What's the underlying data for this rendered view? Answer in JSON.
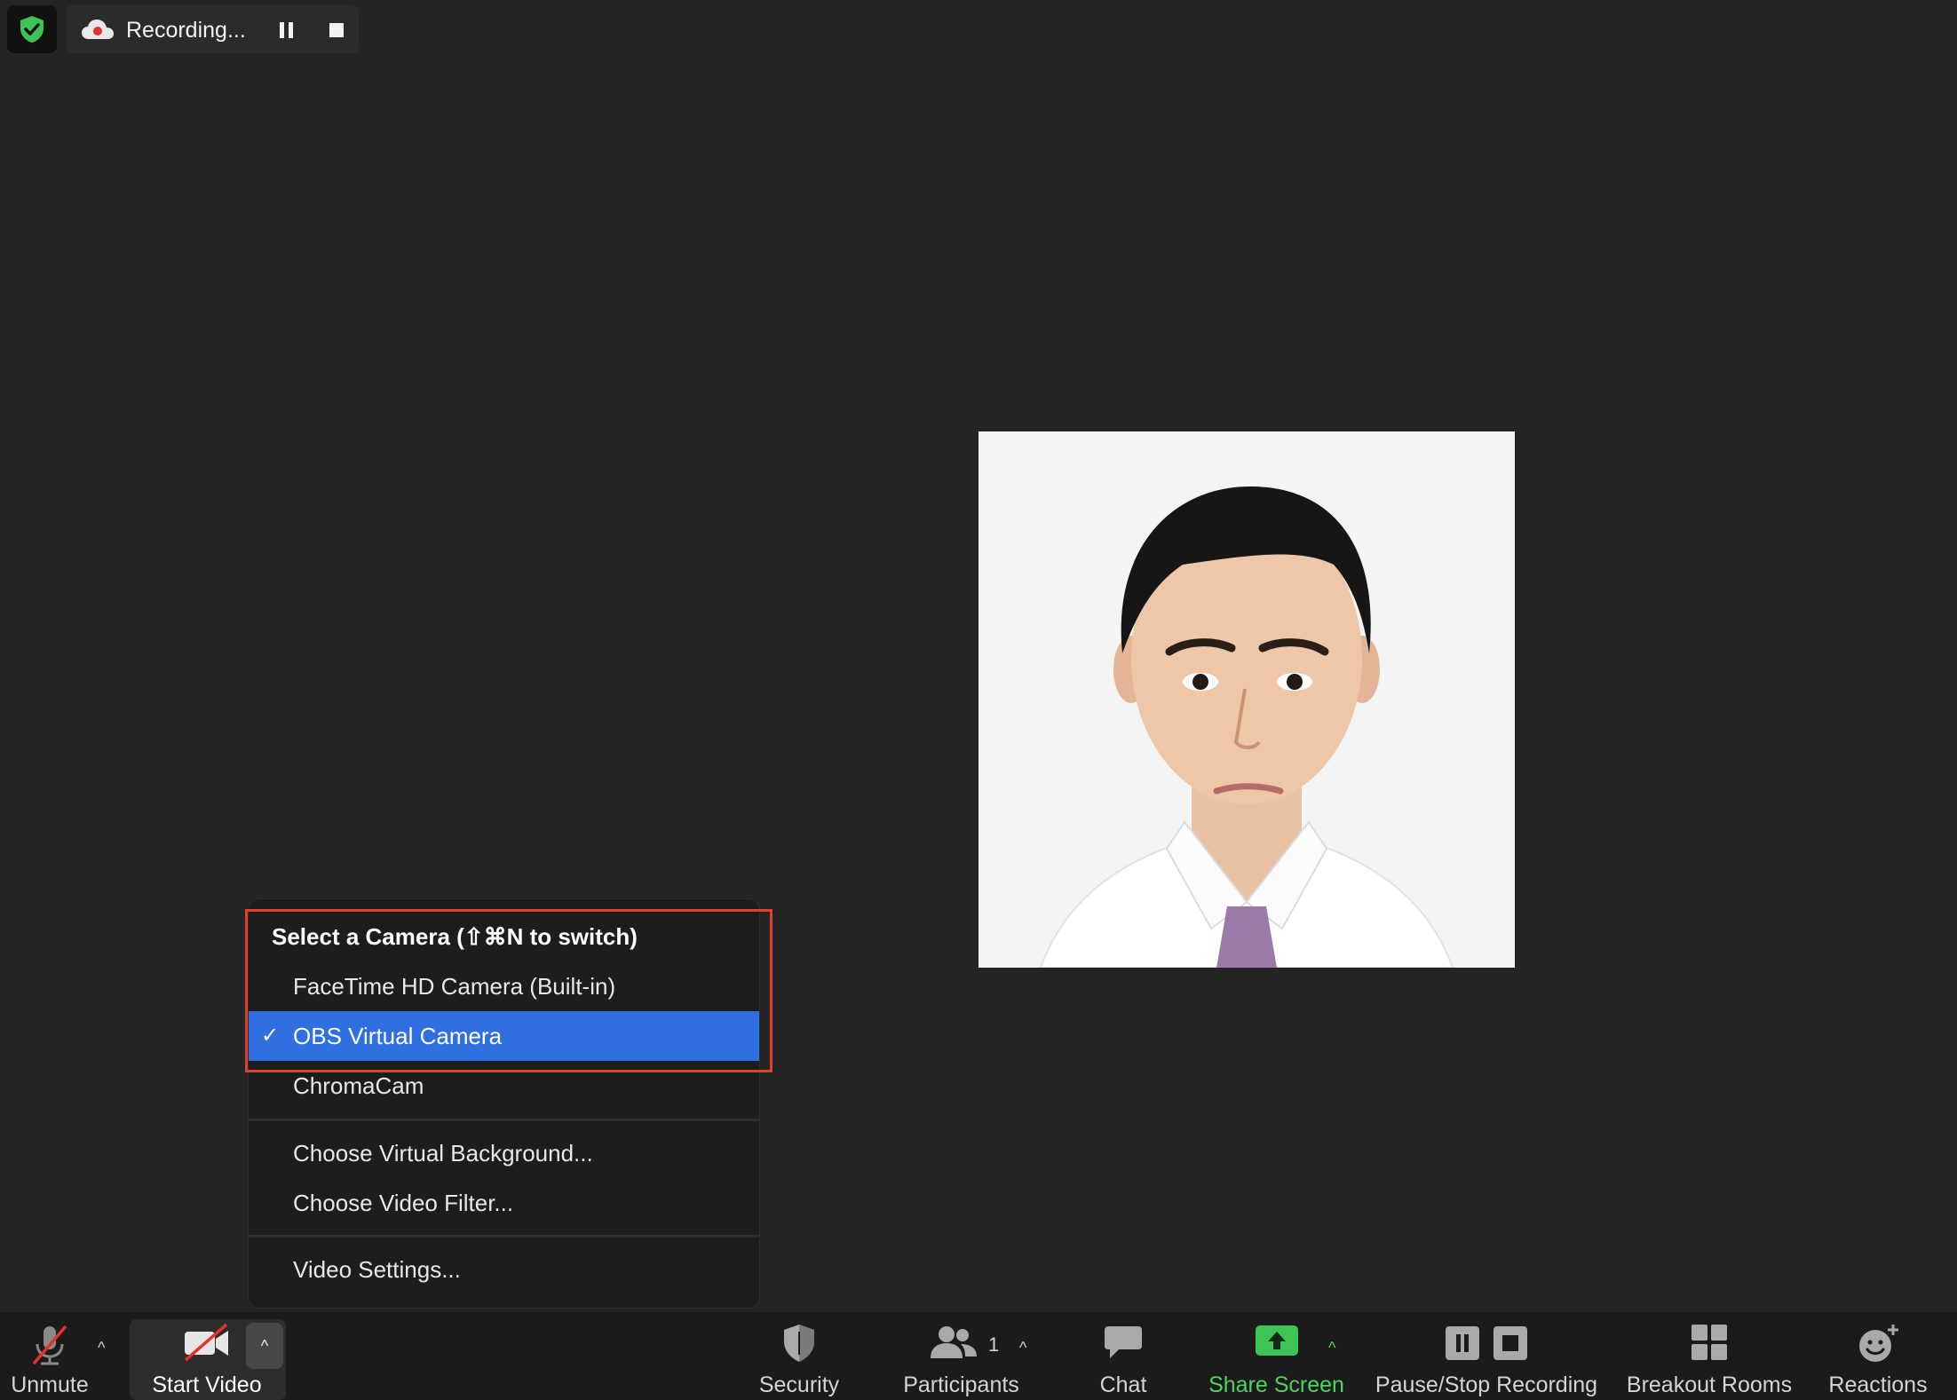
{
  "top_bar": {
    "recording_label": "Recording..."
  },
  "camera_menu": {
    "header": "Select a Camera (⇧⌘N to switch)",
    "cameras": [
      {
        "label": "FaceTime HD Camera (Built-in)",
        "selected": false
      },
      {
        "label": "OBS Virtual Camera",
        "selected": true
      },
      {
        "label": "ChromaCam",
        "selected": false
      }
    ],
    "check_mark": "✓",
    "options": [
      "Choose Virtual Background...",
      "Choose Video Filter..."
    ],
    "settings": "Video Settings..."
  },
  "toolbar": {
    "unmute": "Unmute",
    "start_video": "Start Video",
    "security": "Security",
    "participants": "Participants",
    "participant_count": "1",
    "chat": "Chat",
    "share_screen": "Share Screen",
    "pause_stop_recording": "Pause/Stop Recording",
    "breakout_rooms": "Breakout Rooms",
    "reactions": "Reactions",
    "caret": "^"
  },
  "colors": {
    "background": "#242424",
    "toolbar": "#1b1b1b",
    "selected_item": "#2f6fe0",
    "highlight_border": "#e0402e",
    "share_green": "#4dd45f",
    "security_shield_green": "#4dd45f"
  }
}
